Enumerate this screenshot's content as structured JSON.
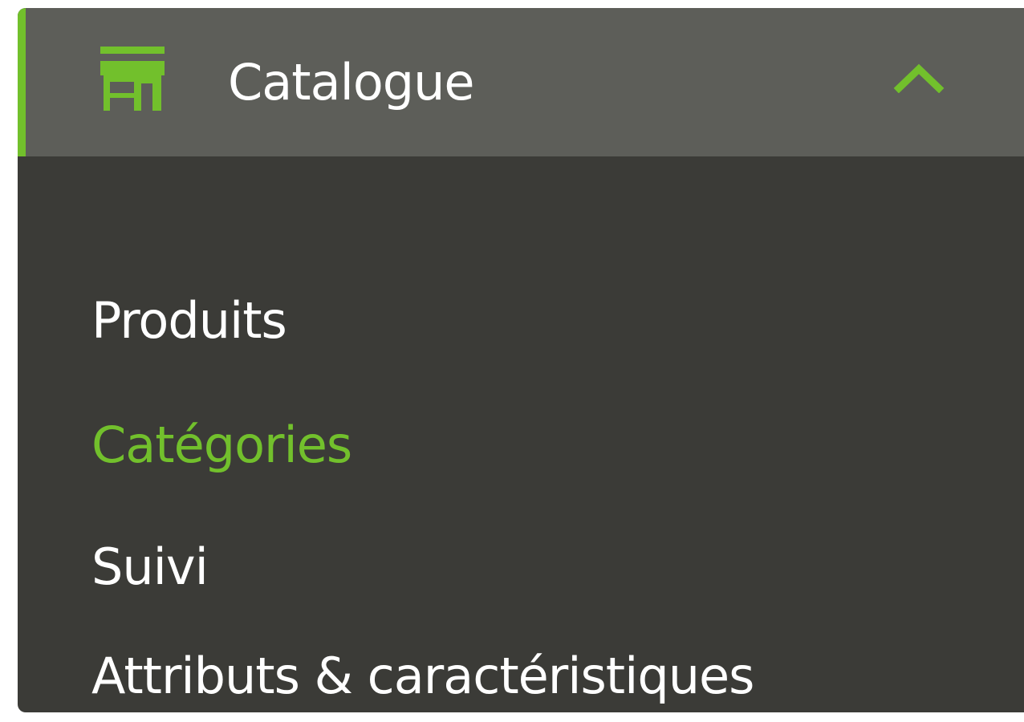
{
  "menu": {
    "title": "Catalogue",
    "icon": "store-icon",
    "toggle_icon": "chevron-up-icon",
    "expanded": true,
    "accent_color": "#72c02c",
    "items": [
      {
        "label": "Produits",
        "active": false
      },
      {
        "label": "Catégories",
        "active": true
      },
      {
        "label": "Suivi",
        "active": false
      },
      {
        "label": "Attributs & caractéristiques",
        "active": false
      }
    ]
  }
}
